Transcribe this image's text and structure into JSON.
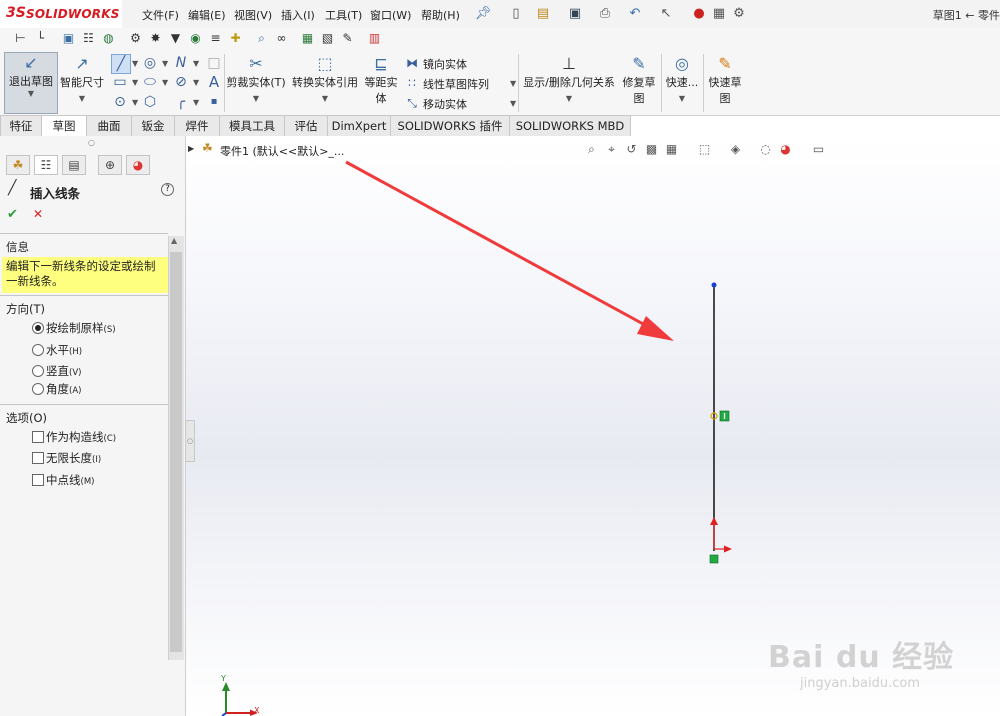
{
  "app": {
    "logo_mark": "3S",
    "logo_text": "SOLIDWORKS",
    "title": "草图1 ← 零件"
  },
  "menu": [
    {
      "label": "文件(F)"
    },
    {
      "label": "编辑(E)"
    },
    {
      "label": "视图(V)"
    },
    {
      "label": "插入(I)"
    },
    {
      "label": "工具(T)"
    },
    {
      "label": "窗口(W)"
    },
    {
      "label": "帮助(H)"
    }
  ],
  "ribbon": {
    "exit_sketch": "退出草图",
    "smart_dim": "智能尺寸",
    "trim": "剪裁实体(T)",
    "convert": "转换实体引用",
    "offset": "等距实体",
    "mirror": "镜向实体",
    "linear_pattern": "线性草图阵列",
    "move": "移动实体",
    "relations": "显示/删除几何关系",
    "repair": "修复草图",
    "quick_snaps": "快速...",
    "rapid_sketch": "快速草图"
  },
  "tabs": [
    "特征",
    "草图",
    "曲面",
    "钣金",
    "焊件",
    "模具工具",
    "评估",
    "DimXpert",
    "SOLIDWORKS 插件",
    "SOLIDWORKS MBD"
  ],
  "active_tab": "草图",
  "panel": {
    "title": "插入线条",
    "info_header": "信息",
    "info_text": "编辑下一新线条的设定或绘制一新线条。",
    "direction_header": "方向(T)",
    "direction_options": [
      {
        "label": "按绘制原样",
        "key": "(S)",
        "selected": true
      },
      {
        "label": "水平",
        "key": "(H)",
        "selected": false
      },
      {
        "label": "竖直",
        "key": "(V)",
        "selected": false
      },
      {
        "label": "角度",
        "key": "(A)",
        "selected": false
      }
    ],
    "options_header": "选项(O)",
    "options": [
      {
        "label": "作为构造线",
        "key": "(C)",
        "checked": false
      },
      {
        "label": "无限长度",
        "key": "(I)",
        "checked": false
      },
      {
        "label": "中点线",
        "key": "(M)",
        "checked": false
      }
    ]
  },
  "tree": {
    "root_label": "零件1 (默认<<默认>_..."
  },
  "triad": {
    "x_label": "X",
    "y_label": "Y"
  },
  "colors": {
    "annotation_arrow": "#ef3b3b",
    "accent_red": "#d71920",
    "highlight": "#ffff7f",
    "sketch_line": "#111111",
    "relation_green": "#22aa44"
  },
  "watermark": {
    "brand": "Bai du 经验",
    "url": "jingyan.baidu.com"
  }
}
